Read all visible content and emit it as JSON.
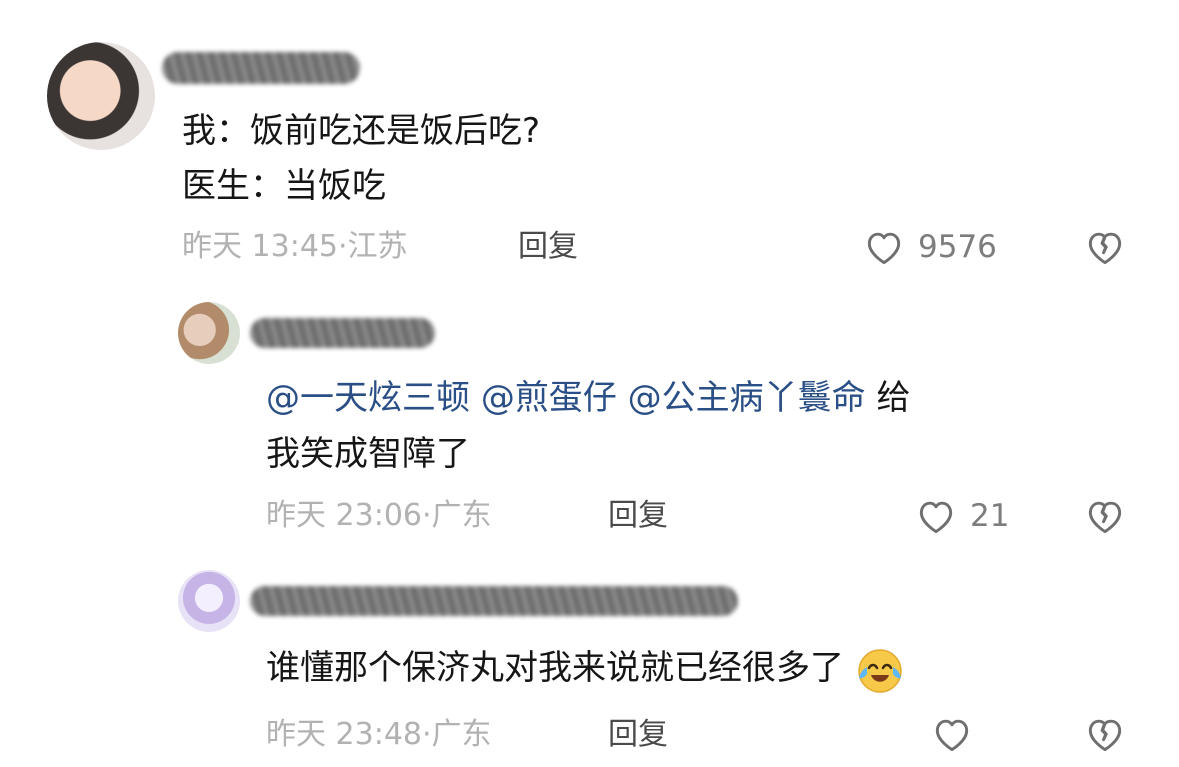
{
  "comments": [
    {
      "text_lines": [
        "我：饭前吃还是饭后吃?",
        "医生：当饭吃"
      ],
      "time": "昨天 13:45·",
      "location": "江苏",
      "reply_label": "回复",
      "likes": "9576"
    },
    {
      "mentions": [
        "@一天炫三顿",
        "@煎蛋仔",
        "@公主病丫鬟命"
      ],
      "text_after": "给",
      "text_line2": "我笑成智障了",
      "time": "昨天 23:06·",
      "location": "广东",
      "reply_label": "回复",
      "likes": "21"
    },
    {
      "text": "谁懂那个保济丸对我来说就已经很多了",
      "time": "昨天 23:48·",
      "location": "广东",
      "reply_label": "回复"
    }
  ],
  "icons": {
    "like": "heart-outline-icon",
    "dislike": "broken-heart-icon",
    "emoji": "crying-laughing-emoji"
  },
  "colors": {
    "mention": "#2a4f86",
    "meta": "#b2b2b2",
    "text": "#161616"
  }
}
